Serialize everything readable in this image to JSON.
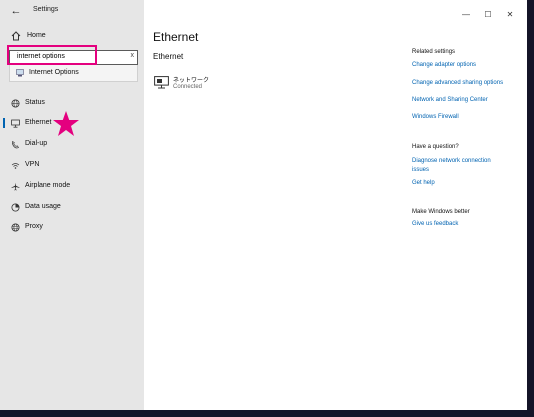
{
  "app": {
    "title": "Settings",
    "back_glyph": "←"
  },
  "window_controls": {
    "minimize": "—",
    "maximize": "☐",
    "close": "✕"
  },
  "sidebar": {
    "home_label": "Home",
    "search": {
      "value": "internet options",
      "clear": "x"
    },
    "suggestion": {
      "label": "Internet Options"
    },
    "items": [
      {
        "label": "Status",
        "icon": "status-globe-icon",
        "active": false
      },
      {
        "label": "Ethernet",
        "icon": "ethernet-monitor-icon",
        "active": true
      },
      {
        "label": "Dial-up",
        "icon": "dial-up-phone-icon",
        "active": false
      },
      {
        "label": "VPN",
        "icon": "vpn-icon",
        "active": false
      },
      {
        "label": "Airplane mode",
        "icon": "airplane-icon",
        "active": false
      },
      {
        "label": "Data usage",
        "icon": "data-usage-icon",
        "active": false
      },
      {
        "label": "Proxy",
        "icon": "proxy-globe-icon",
        "active": false
      }
    ]
  },
  "main": {
    "page_title": "Ethernet",
    "section_title": "Ethernet",
    "network": {
      "name": "ネットワーク",
      "status": "Connected"
    }
  },
  "related": {
    "heading": "Related settings",
    "links": [
      "Change adapter options",
      "Change advanced sharing options",
      "Network and Sharing Center",
      "Windows Firewall"
    ]
  },
  "question": {
    "heading": "Have a question?",
    "links": [
      "Diagnose network connection",
      "issues",
      "Get help"
    ]
  },
  "better": {
    "heading": "Make Windows better",
    "links": [
      "Give us feedback"
    ]
  },
  "colors": {
    "accent": "#0063b1",
    "highlight": "#e4007f",
    "sidebar": "#e6e6e6"
  }
}
